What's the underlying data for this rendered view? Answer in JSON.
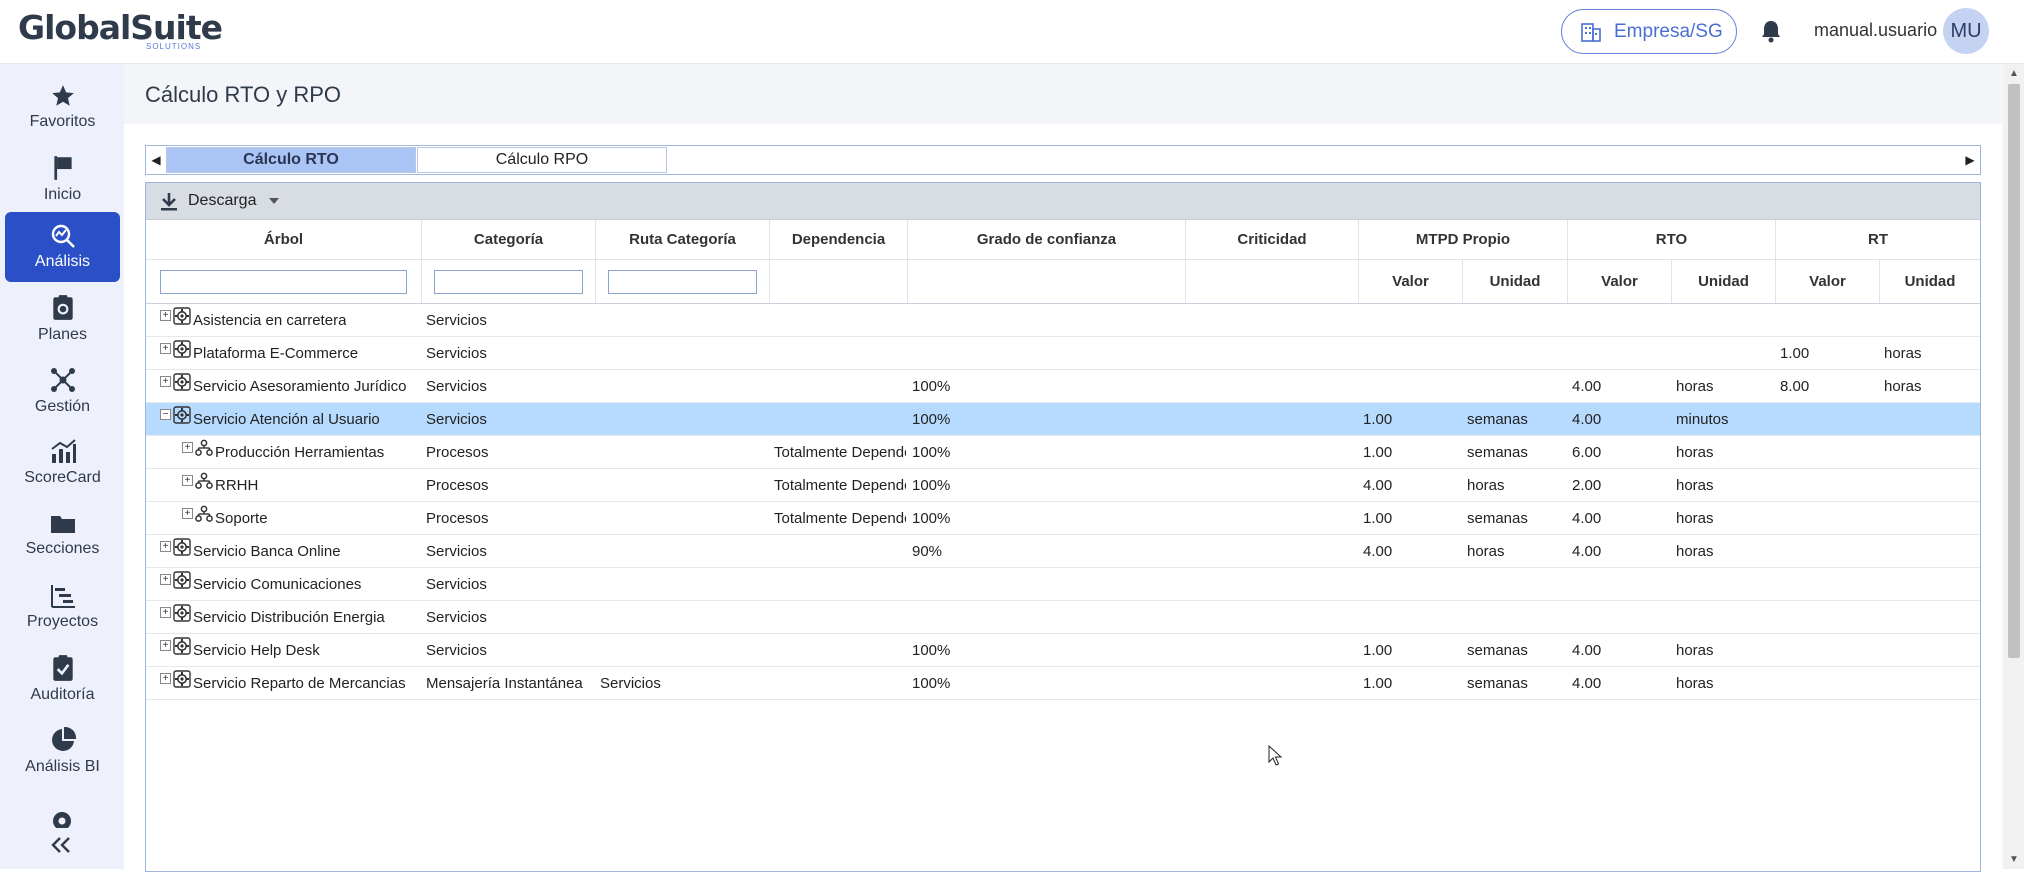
{
  "header": {
    "logo": "GlobalSuite",
    "logo_sub": "SOLUTIONS",
    "company": "Empresa/SG",
    "username": "manual.usuario",
    "avatar": "MU"
  },
  "sidebar": {
    "items": [
      {
        "label": "Favoritos",
        "icon": "star-icon"
      },
      {
        "label": "Inicio",
        "icon": "flag-icon"
      },
      {
        "label": "Análisis",
        "icon": "analysis-icon"
      },
      {
        "label": "Planes",
        "icon": "plans-icon"
      },
      {
        "label": "Gestión",
        "icon": "network-icon"
      },
      {
        "label": "ScoreCard",
        "icon": "bar-chart-icon"
      },
      {
        "label": "Secciones",
        "icon": "folder-icon"
      },
      {
        "label": "Proyectos",
        "icon": "gantt-icon"
      },
      {
        "label": "Auditoría",
        "icon": "clipboard-check-icon"
      },
      {
        "label": "Análisis BI",
        "icon": "pie-chart-icon"
      }
    ],
    "active_index": 2
  },
  "page": {
    "title": "Cálculo RTO y RPO",
    "tabs": [
      "Cálculo RTO",
      "Cálculo RPO"
    ],
    "toolbar_download": "Descarga"
  },
  "table": {
    "columns": {
      "arbol": "Árbol",
      "categoria": "Categoría",
      "ruta": "Ruta Categoría",
      "dependencia": "Dependencia",
      "grado": "Grado de confianza",
      "criticidad": "Criticidad",
      "mtpd": "MTPD Propio",
      "rto": "RTO",
      "rt": "RT",
      "valor": "Valor",
      "unidad": "Unidad"
    },
    "rows": [
      {
        "name": "Asistencia en carretera",
        "level": 0,
        "type": "service",
        "expander": "+",
        "categoria": "Servicios",
        "ruta": "",
        "dependencia": "",
        "grado": "",
        "mtpd_valor": "",
        "mtpd_unidad": "",
        "rto_valor": "",
        "rto_unidad": "",
        "rt_valor": "",
        "rt_unidad": ""
      },
      {
        "name": "Plataforma E-Commerce",
        "level": 0,
        "type": "service",
        "expander": "+",
        "categoria": "Servicios",
        "ruta": "",
        "dependencia": "",
        "grado": "",
        "mtpd_valor": "",
        "mtpd_unidad": "",
        "rto_valor": "",
        "rto_unidad": "",
        "rt_valor": "1.00",
        "rt_unidad": "horas"
      },
      {
        "name": "Servicio Asesoramiento Jurídico",
        "level": 0,
        "type": "service",
        "expander": "+",
        "categoria": "Servicios",
        "ruta": "",
        "dependencia": "",
        "grado": "100%",
        "mtpd_valor": "",
        "mtpd_unidad": "",
        "rto_valor": "4.00",
        "rto_unidad": "horas",
        "rt_valor": "8.00",
        "rt_unidad": "horas"
      },
      {
        "name": "Servicio Atención al Usuario",
        "level": 0,
        "type": "service",
        "expander": "−",
        "selected": true,
        "categoria": "Servicios",
        "ruta": "",
        "dependencia": "",
        "grado": "100%",
        "mtpd_valor": "1.00",
        "mtpd_unidad": "semanas",
        "rto_valor": "4.00",
        "rto_unidad": "minutos",
        "rt_valor": "",
        "rt_unidad": ""
      },
      {
        "name": "Producción Herramientas",
        "level": 1,
        "type": "process",
        "expander": "+",
        "categoria": "Procesos",
        "ruta": "",
        "dependencia": "Totalmente Dependc",
        "grado": "100%",
        "mtpd_valor": "1.00",
        "mtpd_unidad": "semanas",
        "rto_valor": "6.00",
        "rto_unidad": "horas",
        "rt_valor": "",
        "rt_unidad": ""
      },
      {
        "name": "RRHH",
        "level": 1,
        "type": "process",
        "expander": "+",
        "categoria": "Procesos",
        "ruta": "",
        "dependencia": "Totalmente Dependc",
        "grado": "100%",
        "mtpd_valor": "4.00",
        "mtpd_unidad": "horas",
        "rto_valor": "2.00",
        "rto_unidad": "horas",
        "rt_valor": "",
        "rt_unidad": ""
      },
      {
        "name": "Soporte",
        "level": 1,
        "type": "process",
        "expander": "+",
        "categoria": "Procesos",
        "ruta": "",
        "dependencia": "Totalmente Dependc",
        "grado": "100%",
        "mtpd_valor": "1.00",
        "mtpd_unidad": "semanas",
        "rto_valor": "4.00",
        "rto_unidad": "horas",
        "rt_valor": "",
        "rt_unidad": ""
      },
      {
        "name": "Servicio Banca Online",
        "level": 0,
        "type": "service",
        "expander": "+",
        "categoria": "Servicios",
        "ruta": "",
        "dependencia": "",
        "grado": "90%",
        "mtpd_valor": "4.00",
        "mtpd_unidad": "horas",
        "rto_valor": "4.00",
        "rto_unidad": "horas",
        "rt_valor": "",
        "rt_unidad": ""
      },
      {
        "name": "Servicio Comunicaciones",
        "level": 0,
        "type": "service",
        "expander": "+",
        "categoria": "Servicios",
        "ruta": "",
        "dependencia": "",
        "grado": "",
        "mtpd_valor": "",
        "mtpd_unidad": "",
        "rto_valor": "",
        "rto_unidad": "",
        "rt_valor": "",
        "rt_unidad": ""
      },
      {
        "name": "Servicio Distribución Energia",
        "level": 0,
        "type": "service",
        "expander": "+",
        "categoria": "Servicios",
        "ruta": "",
        "dependencia": "",
        "grado": "",
        "mtpd_valor": "",
        "mtpd_unidad": "",
        "rto_valor": "",
        "rto_unidad": "",
        "rt_valor": "",
        "rt_unidad": ""
      },
      {
        "name": "Servicio Help Desk",
        "level": 0,
        "type": "service",
        "expander": "+",
        "categoria": "Servicios",
        "ruta": "",
        "dependencia": "",
        "grado": "100%",
        "mtpd_valor": "1.00",
        "mtpd_unidad": "semanas",
        "rto_valor": "4.00",
        "rto_unidad": "horas",
        "rt_valor": "",
        "rt_unidad": ""
      },
      {
        "name": "Servicio Reparto de Mercancias",
        "level": 0,
        "type": "service",
        "expander": "+",
        "categoria": "Mensajería Instantánea",
        "ruta": "Servicios",
        "dependencia": "",
        "grado": "100%",
        "mtpd_valor": "1.00",
        "mtpd_unidad": "semanas",
        "rto_valor": "4.00",
        "rto_unidad": "horas",
        "rt_valor": "",
        "rt_unidad": ""
      }
    ]
  },
  "colors": {
    "accent": "#2b4fc7",
    "selected_row": "#b7dbff",
    "active_tab": "#a9c4f5",
    "sidebar_bg": "#eef1fb"
  }
}
